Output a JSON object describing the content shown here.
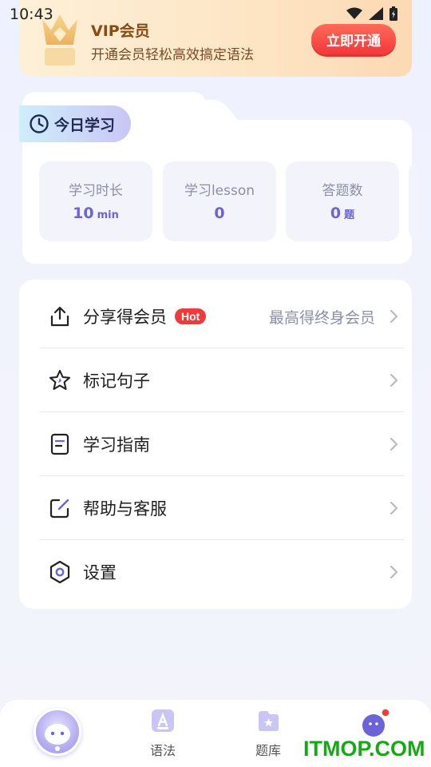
{
  "status_bar": {
    "time": "10:43"
  },
  "vip": {
    "title": "VIP会员",
    "subtitle": "开通会员轻松高效搞定语法",
    "button_label": "立即开通"
  },
  "study": {
    "title": "今日学习",
    "stats": [
      {
        "label": "学习时长",
        "value": "10",
        "unit": "min"
      },
      {
        "label": "学习lesson",
        "value": "0",
        "unit": ""
      },
      {
        "label": "答题数",
        "value": "0",
        "unit": "题"
      }
    ]
  },
  "menu": {
    "items": [
      {
        "icon": "share-icon",
        "label": "分享得会员",
        "badge": "Hot",
        "hint": "最高得终身会员"
      },
      {
        "icon": "star-icon",
        "label": "标记句子"
      },
      {
        "icon": "document-icon",
        "label": "学习指南"
      },
      {
        "icon": "edit-icon",
        "label": "帮助与客服"
      },
      {
        "icon": "settings-hexagon-icon",
        "label": "设置"
      }
    ]
  },
  "bottom_nav": {
    "items": [
      {
        "icon": "avatar-icon",
        "label": ""
      },
      {
        "icon": "grammar-icon",
        "label": "语法"
      },
      {
        "icon": "question-bank-icon",
        "label": "题库"
      },
      {
        "icon": "me-icon",
        "label": ""
      }
    ]
  },
  "watermark": "ITMOP.COM",
  "colors": {
    "accent": "#6b63d8",
    "vip_button": "#f4383a",
    "hot_badge": "#f23a3a",
    "watermark": "#15a915"
  }
}
